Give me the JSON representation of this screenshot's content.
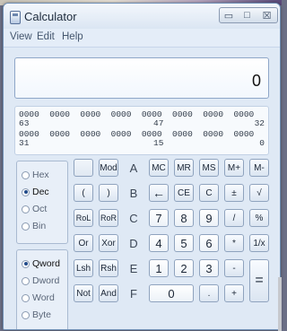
{
  "window": {
    "title": "Calculator"
  },
  "window_controls": {
    "minimize": "▭",
    "maximize": "□",
    "close": "☒"
  },
  "menu": [
    "View",
    "Edit",
    "Help"
  ],
  "display": {
    "value": "0"
  },
  "bits": {
    "row1": "0000  0000  0000  0000  0000  0000  0000  0000",
    "row1_labels": [
      "63",
      "47",
      "32"
    ],
    "row2": "0000  0000  0000  0000  0000  0000  0000  0000",
    "row2_labels": [
      "31",
      "15",
      "0"
    ]
  },
  "base_group": {
    "options": [
      "Hex",
      "Dec",
      "Oct",
      "Bin"
    ],
    "selected": "Dec"
  },
  "word_group": {
    "options": [
      "Qword",
      "Dword",
      "Word",
      "Byte"
    ],
    "selected": "Qword"
  },
  "keys": {
    "row1": [
      "",
      "Mod",
      "A",
      "MC",
      "MR",
      "MS",
      "M+",
      "M-"
    ],
    "row2": [
      "(",
      ")",
      "B",
      "←",
      "CE",
      "C",
      "±",
      "√"
    ],
    "row3": [
      "RoL",
      "RoR",
      "C",
      "7",
      "8",
      "9",
      "/",
      "%"
    ],
    "row4": [
      "Or",
      "Xor",
      "D",
      "4",
      "5",
      "6",
      "*",
      "1/x"
    ],
    "row5": [
      "Lsh",
      "Rsh",
      "E",
      "1",
      "2",
      "3",
      "-",
      "="
    ],
    "row6": [
      "Not",
      "And",
      "F",
      "0",
      ".",
      "+"
    ]
  }
}
